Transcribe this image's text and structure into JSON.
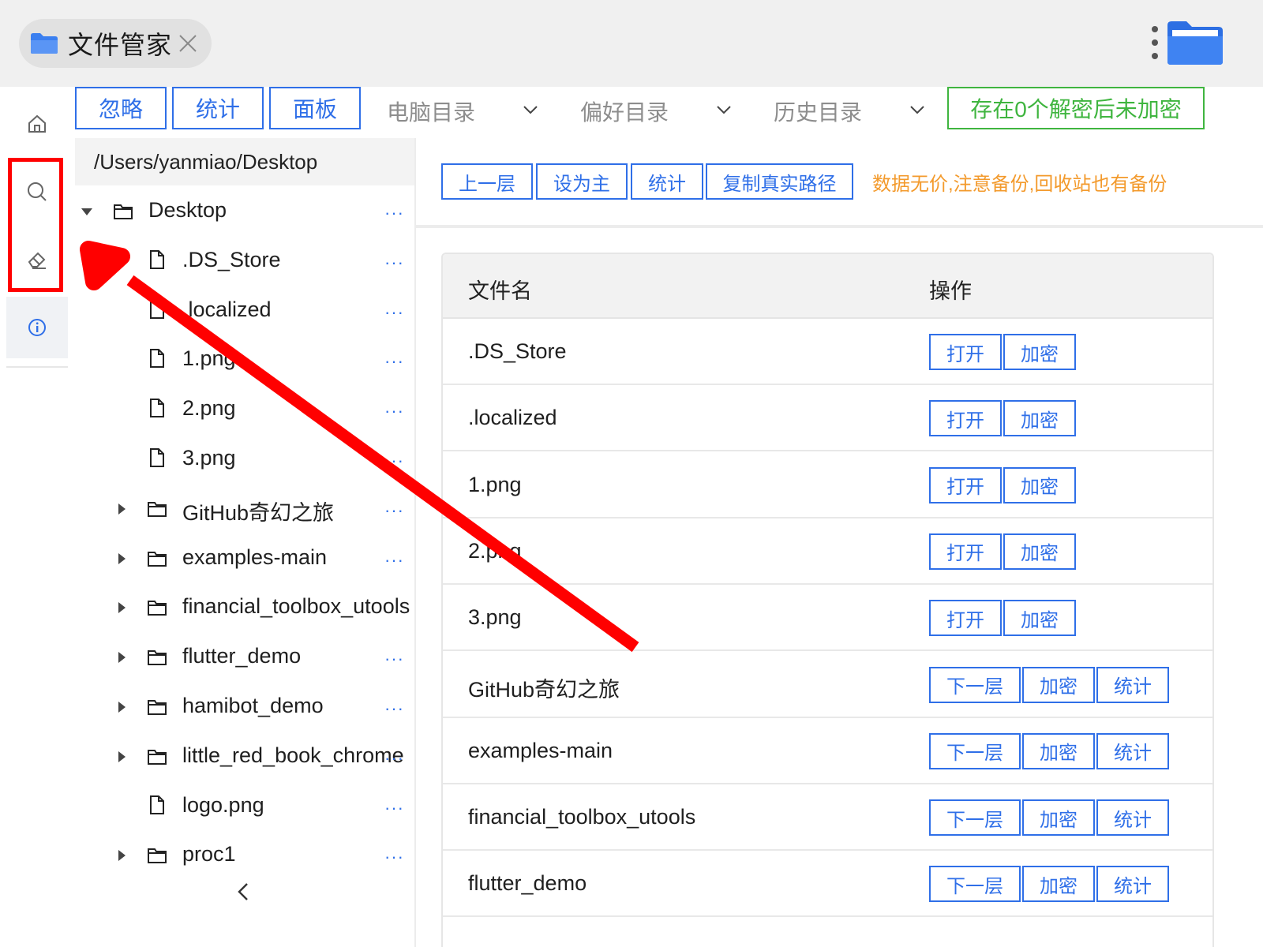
{
  "window": {
    "tab_title": "文件管家"
  },
  "toolbar": {
    "ignore_label": "忽略",
    "stats_label": "统计",
    "panel_label": "面板",
    "dropdowns": [
      {
        "label": "电脑目录"
      },
      {
        "label": "偏好目录"
      },
      {
        "label": "历史目录"
      }
    ],
    "status_label": "存在0个解密后未加密"
  },
  "tree": {
    "path": "/Users/yanmiao/Desktop",
    "more": "···",
    "items": [
      {
        "label": "Desktop",
        "kind": "folder",
        "expanded": true
      },
      {
        "label": ".DS_Store",
        "kind": "file"
      },
      {
        "label": ".localized",
        "kind": "file"
      },
      {
        "label": "1.png",
        "kind": "file"
      },
      {
        "label": "2.png",
        "kind": "file"
      },
      {
        "label": "3.png",
        "kind": "file"
      },
      {
        "label": "GitHub奇幻之旅",
        "kind": "folder"
      },
      {
        "label": "examples-main",
        "kind": "folder"
      },
      {
        "label": "financial_toolbox_utools",
        "kind": "folder"
      },
      {
        "label": "flutter_demo",
        "kind": "folder"
      },
      {
        "label": "hamibot_demo",
        "kind": "folder"
      },
      {
        "label": "little_red_book_chrome",
        "kind": "folder"
      },
      {
        "label": "logo.png",
        "kind": "file"
      },
      {
        "label": "proc1",
        "kind": "folder"
      }
    ]
  },
  "path_bar": {
    "up_label": "上一层",
    "set_main_label": "设为主",
    "stats_label": "统计",
    "copy_path_label": "复制真实路径",
    "warning": "数据无价,注意备份,回收站也有备份"
  },
  "table": {
    "headers": [
      "文件名",
      "操作"
    ],
    "rows": [
      {
        "name": ".DS_Store",
        "actions": [
          "打开",
          "加密"
        ]
      },
      {
        "name": ".localized",
        "actions": [
          "打开",
          "加密"
        ]
      },
      {
        "name": "1.png",
        "actions": [
          "打开",
          "加密"
        ]
      },
      {
        "name": "2.png",
        "actions": [
          "打开",
          "加密"
        ]
      },
      {
        "name": "3.png",
        "actions": [
          "打开",
          "加密"
        ]
      },
      {
        "name": "GitHub奇幻之旅",
        "actions": [
          "下一层",
          "加密",
          "统计"
        ]
      },
      {
        "name": "examples-main",
        "actions": [
          "下一层",
          "加密",
          "统计"
        ]
      },
      {
        "name": "financial_toolbox_utools",
        "actions": [
          "下一层",
          "加密",
          "统计"
        ]
      },
      {
        "name": "flutter_demo",
        "actions": [
          "下一层",
          "加密",
          "统计"
        ]
      }
    ]
  },
  "colors": {
    "accent": "#2f6fe8",
    "success": "#3fb53f",
    "warning": "#f39a2c",
    "annotation": "#ff0000"
  },
  "icons": {
    "sidebar": [
      "home-icon",
      "search-icon",
      "eraser-icon",
      "info-icon"
    ]
  }
}
